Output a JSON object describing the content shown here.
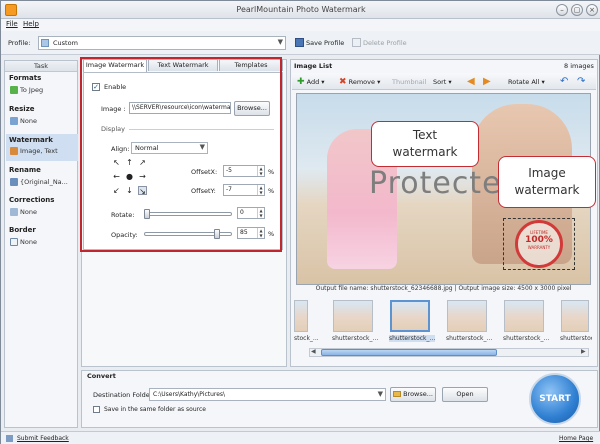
{
  "window": {
    "title": "PearlMountain Photo Watermark",
    "btn_minimize": "–",
    "btn_restore": "▢",
    "btn_close": "×"
  },
  "menu": {
    "file": "File",
    "help": "Help"
  },
  "profile": {
    "label": "Profile:",
    "value": "Custom",
    "save": "Save Profile",
    "delete": "Delete Profile"
  },
  "task": {
    "header": "Task",
    "sections": [
      {
        "title": "Formats",
        "value": "To Jpeg"
      },
      {
        "title": "Resize",
        "value": "None"
      },
      {
        "title": "Watermark",
        "value": "Image, Text"
      },
      {
        "title": "Rename",
        "value": "{Original_Na..."
      },
      {
        "title": "Corrections",
        "value": "None"
      },
      {
        "title": "Border",
        "value": "None"
      }
    ]
  },
  "tabs": {
    "image": "Image Watermark",
    "text": "Text Watermark",
    "templates": "Templates"
  },
  "watermark": {
    "enable": "Enable",
    "image_label": "Image :",
    "image_path": "\\\\SERVER\\resource\\icon\\waterma",
    "browse": "Browse...",
    "display": "Display",
    "align_label": "Align:",
    "align_value": "Normal",
    "offsetx_label": "OffsetX:",
    "offsetx_value": "-5",
    "offsety_label": "OffsetY:",
    "offsety_value": "-7",
    "percent": "%",
    "rotate_label": "Rotate:",
    "rotate_value": "0",
    "opacity_label": "Opacity:",
    "opacity_value": "85",
    "rotate_level_deg": 0,
    "opacity_level_pct": 85
  },
  "image_list": {
    "header": "Image List",
    "count": "8 images",
    "add": "Add",
    "remove": "Remove",
    "thumbnail": "Thumbnail",
    "sort": "Sort",
    "rotate_all": "Rotate All",
    "preview_text": "Protected",
    "output_info": "Output file name: shutterstock_62346688.jpg | Output image size: 4500 x 3000 pixel",
    "stamp_top": "LIFETIME",
    "stamp_mid": "100%",
    "stamp_bot": "WARRANTY",
    "thumbnails": [
      "stock_...",
      "shutterstock_...",
      "shutterstock_...",
      "shutterstock_...",
      "shutterstock_...",
      "shutterstock_..."
    ]
  },
  "callouts": {
    "text_line1": "Text",
    "text_line2": "watermark",
    "image_line1": "Image",
    "image_line2": "watermark"
  },
  "convert": {
    "header": "Convert",
    "dest_label": "Destination Folder:",
    "dest_value": "C:\\Users\\Kathy\\Pictures\\",
    "browse": "Browse...",
    "open": "Open",
    "same_folder": "Save in the same folder as source",
    "start": "START"
  },
  "status": {
    "feedback": "Submit Feedback",
    "home": "Home Page"
  },
  "colors": {
    "accent_red": "#c0262e",
    "start_blue": "#2f7fd2",
    "selection": "#cfdef0"
  }
}
